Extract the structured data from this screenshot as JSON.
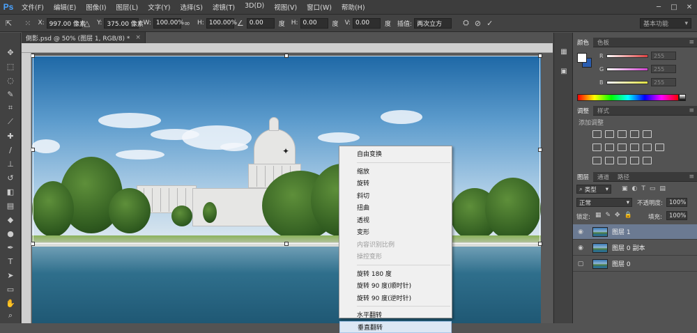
{
  "app": {
    "logo": "Ps"
  },
  "menu": [
    "文件(F)",
    "编辑(E)",
    "图像(I)",
    "图层(L)",
    "文字(Y)",
    "选择(S)",
    "滤镜(T)",
    "3D(D)",
    "视图(V)",
    "窗口(W)",
    "帮助(H)"
  ],
  "window_controls": {
    "minimize": "─",
    "maximize": "□",
    "close": "✕"
  },
  "options": {
    "x_label": "X:",
    "x_value": "997.00 像素",
    "y_label": "Y:",
    "y_value": "375.00 像素",
    "w_label": "W:",
    "w_value": "100.00%",
    "h_label": "H:",
    "h_value": "100.00%",
    "angle_value": "0.00",
    "angle_unit": "度",
    "hskew_label": "H:",
    "hskew_value": "0.00",
    "hskew_unit": "度",
    "vskew_label": "V:",
    "vskew_value": "0.00",
    "vskew_unit": "度",
    "interp_label": "插值:",
    "interp_value": "两次立方",
    "workspace": "基本功能"
  },
  "document": {
    "tab_title": "倒影.psd @ 50% (图层 1, RGB/8) *",
    "close": "×"
  },
  "context_menu": {
    "group1": [
      "自由变换"
    ],
    "group2": [
      "缩放",
      "旋转",
      "斜切",
      "扭曲",
      "透视",
      "变形"
    ],
    "disabled": [
      "内容识别比例",
      "操控变形"
    ],
    "group3": [
      "旋转 180 度",
      "旋转 90 度(顺时针)",
      "旋转 90 度(逆时针)"
    ],
    "group4": [
      "水平翻转",
      "垂直翻转"
    ]
  },
  "color_panel": {
    "tabs": [
      "颜色",
      "色板"
    ],
    "sliders": [
      {
        "label": "R",
        "value": "255",
        "color": "#e04040"
      },
      {
        "label": "G",
        "value": "255",
        "color": "#d040d0"
      },
      {
        "label": "B",
        "value": "255",
        "color": "#e0e040"
      }
    ]
  },
  "adjust_panel": {
    "tabs": [
      "调整",
      "样式"
    ],
    "title": "添加调整"
  },
  "layers_panel": {
    "tabs": [
      "图层",
      "通道",
      "路径"
    ],
    "filter_label": "类型",
    "blend_mode": "正常",
    "opacity_label": "不透明度:",
    "opacity_value": "100%",
    "lock_label": "锁定:",
    "fill_label": "填充:",
    "fill_value": "100%",
    "layers": [
      {
        "name": "图层 1",
        "selected": true
      },
      {
        "name": "图层 0 副本",
        "selected": false
      },
      {
        "name": "图层 0",
        "selected": false
      }
    ]
  },
  "colors": {
    "accent": "#4aa3ff",
    "menu_hover": "#dce7f4"
  }
}
